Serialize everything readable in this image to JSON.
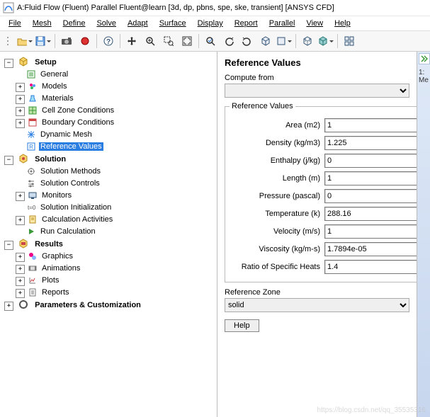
{
  "window": {
    "title": "A:Fluid Flow (Fluent) Parallel Fluent@learn  [3d, dp, pbns, spe, ske, transient] [ANSYS CFD]"
  },
  "menubar": {
    "file": "File",
    "mesh": "Mesh",
    "define": "Define",
    "solve": "Solve",
    "adapt": "Adapt",
    "surface": "Surface",
    "display": "Display",
    "report": "Report",
    "parallel": "Parallel",
    "view": "View",
    "help": "Help"
  },
  "tree": {
    "setup": {
      "label": "Setup",
      "items": {
        "general": "General",
        "models": "Models",
        "materials": "Materials",
        "cellzone": "Cell Zone Conditions",
        "boundary": "Boundary Conditions",
        "dynamicmesh": "Dynamic Mesh",
        "refvalues": "Reference Values"
      }
    },
    "solution": {
      "label": "Solution",
      "items": {
        "methods": "Solution Methods",
        "controls": "Solution Controls",
        "monitors": "Monitors",
        "init": "Solution Initialization",
        "calcact": "Calculation Activities",
        "run": "Run Calculation"
      }
    },
    "results": {
      "label": "Results",
      "items": {
        "graphics": "Graphics",
        "animations": "Animations",
        "plots": "Plots",
        "reports": "Reports"
      }
    },
    "params": {
      "label": "Parameters & Customization"
    }
  },
  "panel": {
    "title": "Reference Values",
    "compute_from_label": "Compute from",
    "compute_from_value": "",
    "group_label": "Reference Values",
    "fields": {
      "area": {
        "label": "Area (m2)",
        "value": "1"
      },
      "density": {
        "label": "Density (kg/m3)",
        "value": "1.225"
      },
      "enthalpy": {
        "label": "Enthalpy (j/kg)",
        "value": "0"
      },
      "length": {
        "label": "Length (m)",
        "value": "1"
      },
      "pressure": {
        "label": "Pressure (pascal)",
        "value": "0"
      },
      "temperature": {
        "label": "Temperature (k)",
        "value": "288.16"
      },
      "velocity": {
        "label": "Velocity (m/s)",
        "value": "1"
      },
      "viscosity": {
        "label": "Viscosity (kg/m-s)",
        "value": "1.7894e-05"
      },
      "ratio": {
        "label": "Ratio of Specific Heats",
        "value": "1.4"
      }
    },
    "refzone_label": "Reference Zone",
    "refzone_value": "solid",
    "help": "Help"
  },
  "right": {
    "tab": "1: Me"
  },
  "watermark": "https://blog.csdn.net/qq_35535316"
}
